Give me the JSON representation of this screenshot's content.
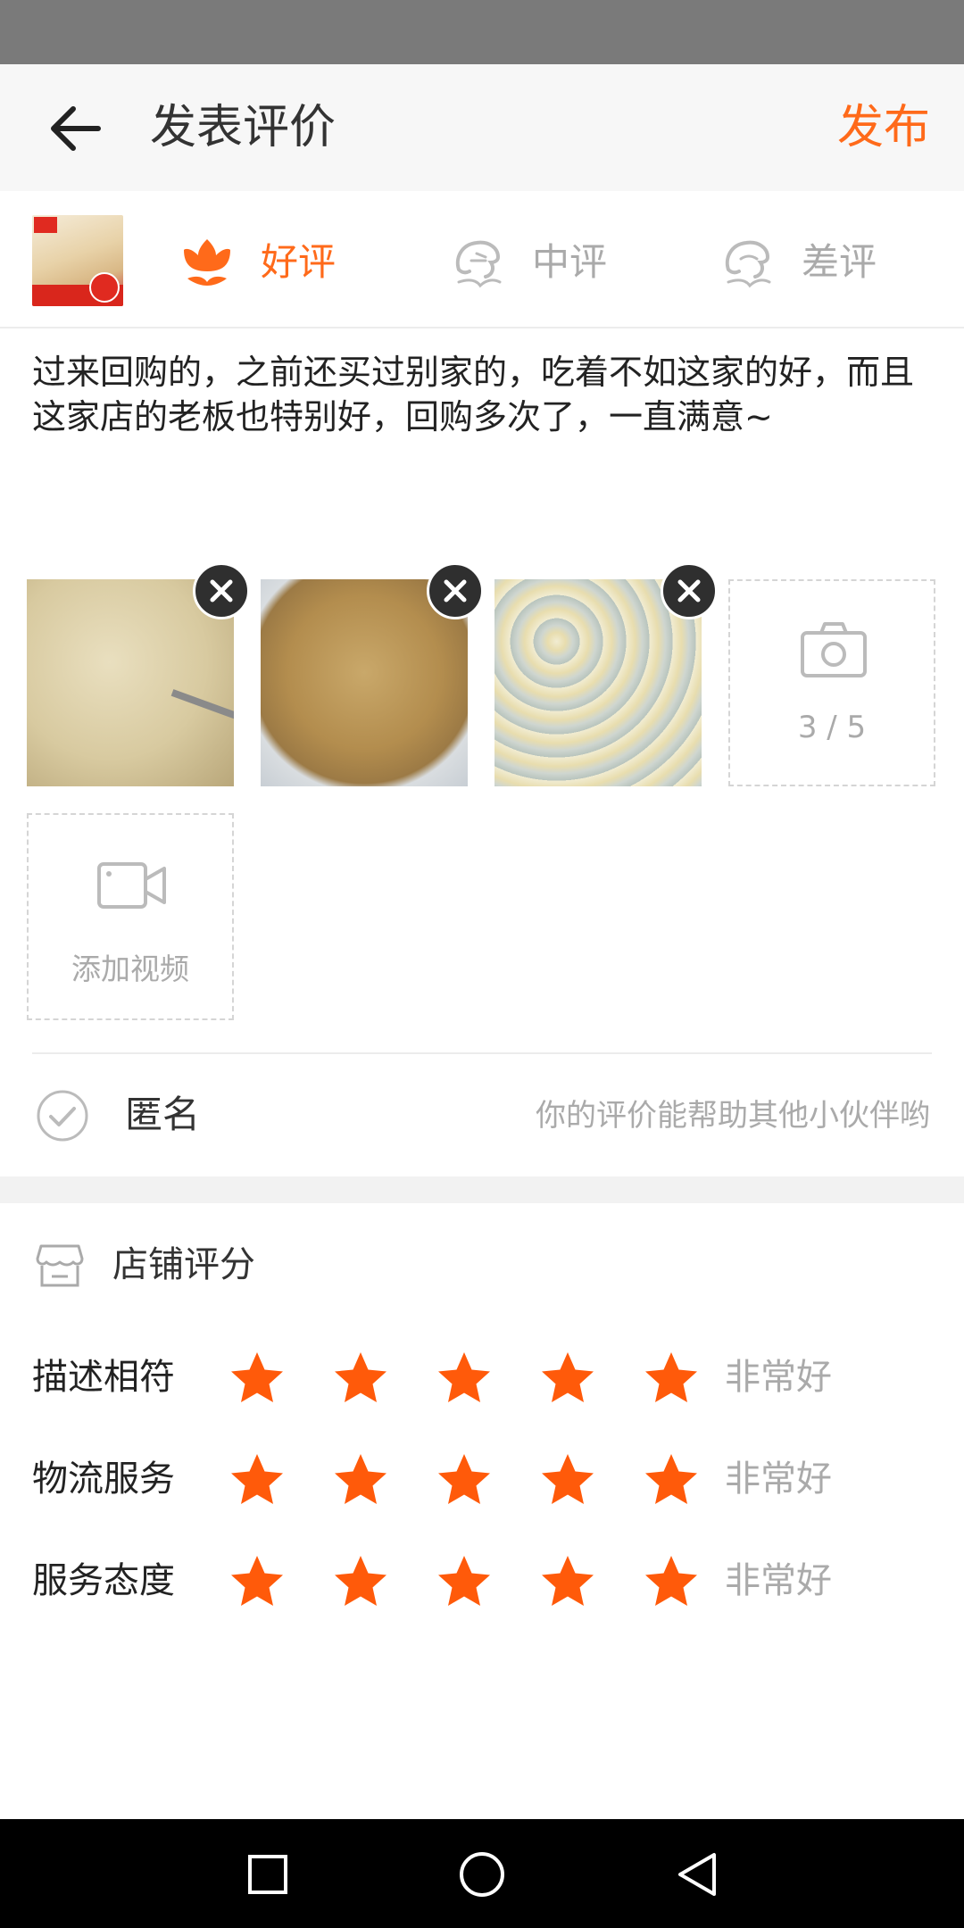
{
  "header": {
    "title": "发表评价",
    "publish_label": "发布"
  },
  "rating": {
    "options": [
      {
        "label": "好评",
        "icon": "flower-icon",
        "selected": true
      },
      {
        "label": "中评",
        "icon": "neutral-face-icon",
        "selected": false
      },
      {
        "label": "差评",
        "icon": "sad-face-icon",
        "selected": false
      }
    ]
  },
  "review": {
    "text": "过来回购的，之前还买过别家的，吃着不如这家的好，而且这家店的老板也特别好，回购多次了，一直满意~"
  },
  "media": {
    "photo_count": "3 / 5",
    "add_video_label": "添加视频"
  },
  "anonymous": {
    "label": "匿名",
    "hint": "你的评价能帮助其他小伙伴哟"
  },
  "shop_rating": {
    "title": "店铺评分",
    "rows": [
      {
        "name": "描述相符",
        "stars": 5,
        "verdict": "非常好"
      },
      {
        "name": "物流服务",
        "stars": 5,
        "verdict": "非常好"
      },
      {
        "name": "服务态度",
        "stars": 5,
        "verdict": "非常好"
      }
    ]
  },
  "colors": {
    "accent": "#ff6a1a",
    "star": "#ff5a0a",
    "muted": "#aaaaaa"
  }
}
